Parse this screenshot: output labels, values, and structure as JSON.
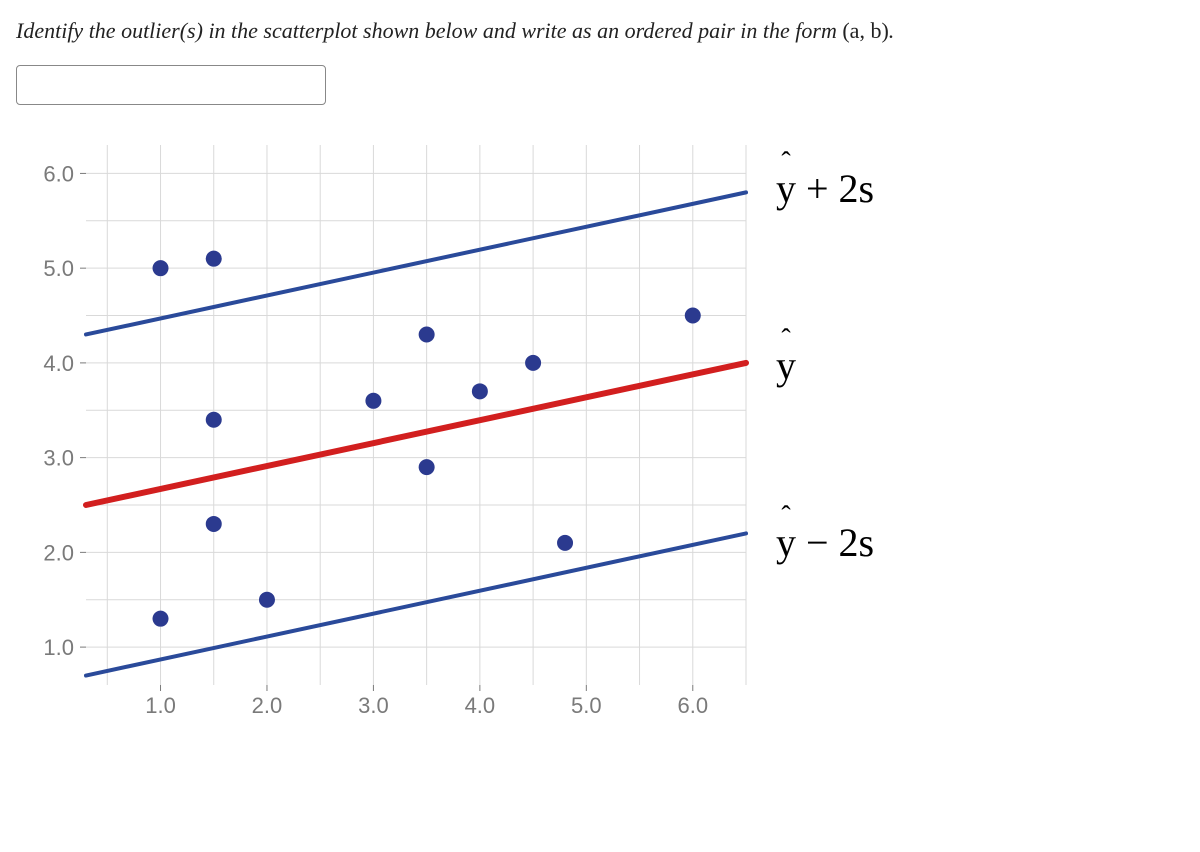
{
  "question": {
    "prefix": "Identify the outlier(s) in the scatterplot shown below and write as an ordered pair in the form ",
    "math": "(a, b)",
    "suffix": "."
  },
  "answer_value": "",
  "legend": {
    "upper": "ŷ + 2s",
    "mid": "ŷ",
    "lower": "ŷ − 2s"
  },
  "chart_data": {
    "type": "scatter",
    "title": "",
    "xlabel": "",
    "ylabel": "",
    "xlim": [
      0.3,
      6.5
    ],
    "ylim": [
      0.6,
      6.3
    ],
    "x_ticks": [
      1.0,
      2.0,
      3.0,
      4.0,
      5.0,
      6.0
    ],
    "y_ticks": [
      1.0,
      2.0,
      3.0,
      4.0,
      5.0,
      6.0
    ],
    "x_tick_labels": [
      "1.0",
      "2.0",
      "3.0",
      "4.0",
      "5.0",
      "6.0"
    ],
    "y_tick_labels": [
      "1.0",
      "2.0",
      "3.0",
      "4.0",
      "5.0",
      "6.0"
    ],
    "grid": true,
    "series": [
      {
        "name": "data points",
        "type": "scatter",
        "color": "#2b3a8f",
        "x": [
          1.0,
          1.0,
          1.5,
          1.5,
          1.5,
          2.0,
          3.0,
          3.5,
          3.5,
          4.0,
          4.5,
          4.8,
          6.0
        ],
        "y": [
          5.0,
          1.3,
          3.4,
          2.3,
          5.1,
          1.5,
          3.6,
          4.3,
          2.9,
          3.7,
          4.0,
          2.1,
          4.5
        ]
      },
      {
        "name": "ŷ (regression line)",
        "type": "line",
        "color": "#d21f1f",
        "x": [
          0.3,
          6.5
        ],
        "y": [
          2.5,
          4.0
        ]
      },
      {
        "name": "ŷ + 2s",
        "type": "line",
        "color": "#2a4a9a",
        "x": [
          0.3,
          6.5
        ],
        "y": [
          4.3,
          5.8
        ]
      },
      {
        "name": "ŷ − 2s",
        "type": "line",
        "color": "#2a4a9a",
        "x": [
          0.3,
          6.5
        ],
        "y": [
          0.7,
          2.2
        ]
      }
    ]
  }
}
